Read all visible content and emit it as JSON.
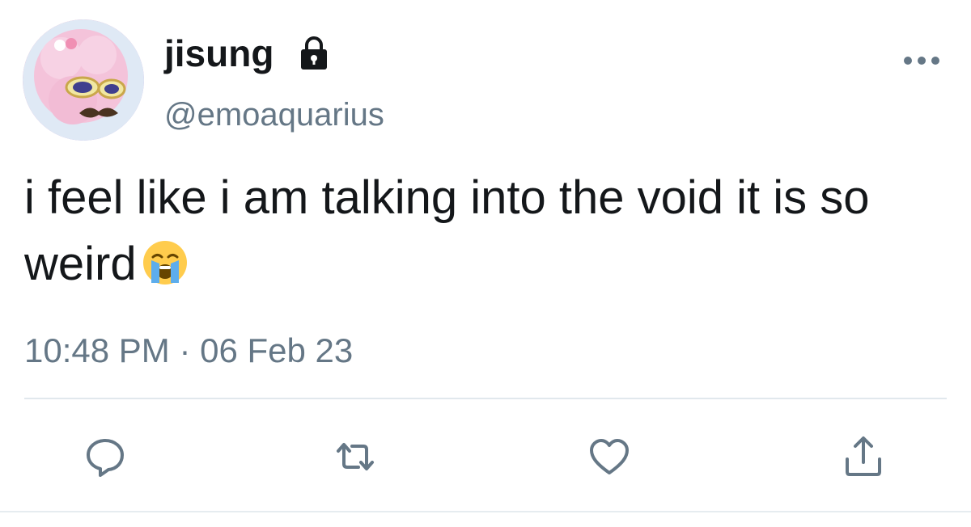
{
  "user": {
    "display_name": "jisung",
    "handle": "@emoaquarius",
    "protected_icon": "lock-icon",
    "avatar": "avatar-image"
  },
  "tweet": {
    "text": "i feel like i am talking into the void it is so weird",
    "emoji": "loudly-crying-face-emoji",
    "timestamp": "10:48 PM · 06 Feb 23"
  },
  "menu": {
    "icon": "more-icon"
  },
  "actions": [
    {
      "name": "reply",
      "icon": "reply-icon"
    },
    {
      "name": "retweet",
      "icon": "retweet-icon"
    },
    {
      "name": "like",
      "icon": "heart-icon"
    },
    {
      "name": "share",
      "icon": "share-icon"
    }
  ],
  "colors": {
    "text_primary": "#14171a",
    "text_secondary": "#657786",
    "icon": "#657786",
    "divider": "#e1e8ed"
  }
}
